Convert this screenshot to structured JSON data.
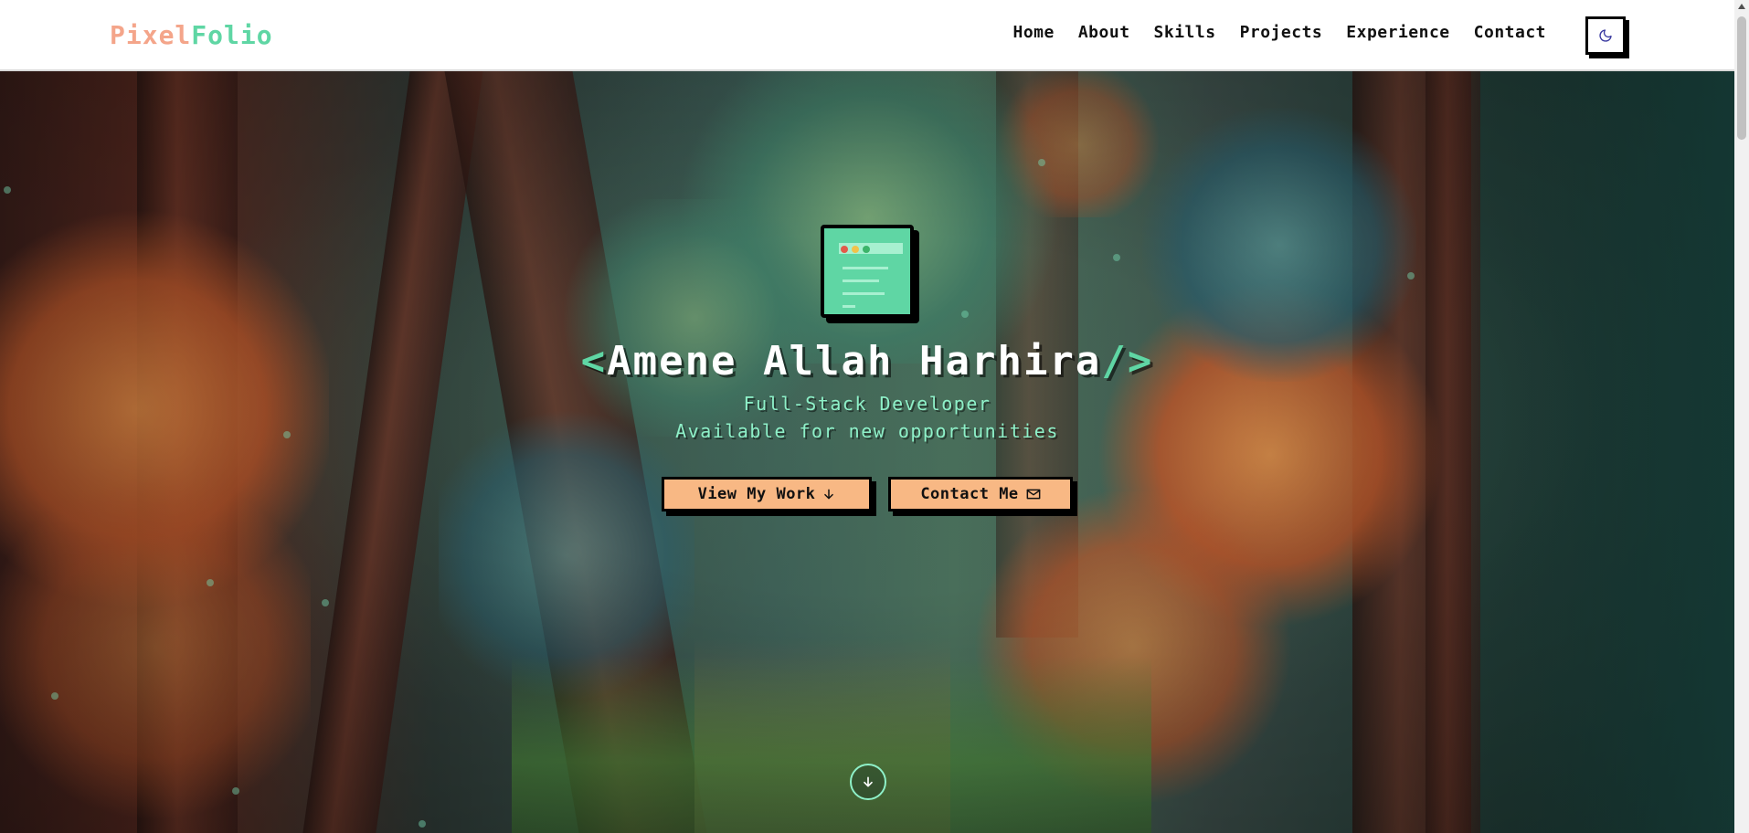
{
  "brand": {
    "part1": "Pixel",
    "part2": "Folio"
  },
  "nav": {
    "links": [
      "Home",
      "About",
      "Skills",
      "Projects",
      "Experience",
      "Contact"
    ],
    "theme_toggle_icon": "moon-icon"
  },
  "hero": {
    "name": "Amene Allah Harhira",
    "bracket_open": "<",
    "bracket_close": "/>",
    "role": "Full-Stack Developer",
    "status": "Available for new opportunities",
    "primary_button": {
      "label": "View My Work",
      "icon": "arrow-down-icon"
    },
    "secondary_button": {
      "label": "Contact Me",
      "icon": "mail-icon"
    },
    "scroll_icon": "arrow-down-circle-icon"
  },
  "colors": {
    "accent_green": "#5fd6a4",
    "accent_peach": "#f8b884",
    "logo_pink": "#f4a58a",
    "text_dark": "#111111"
  }
}
